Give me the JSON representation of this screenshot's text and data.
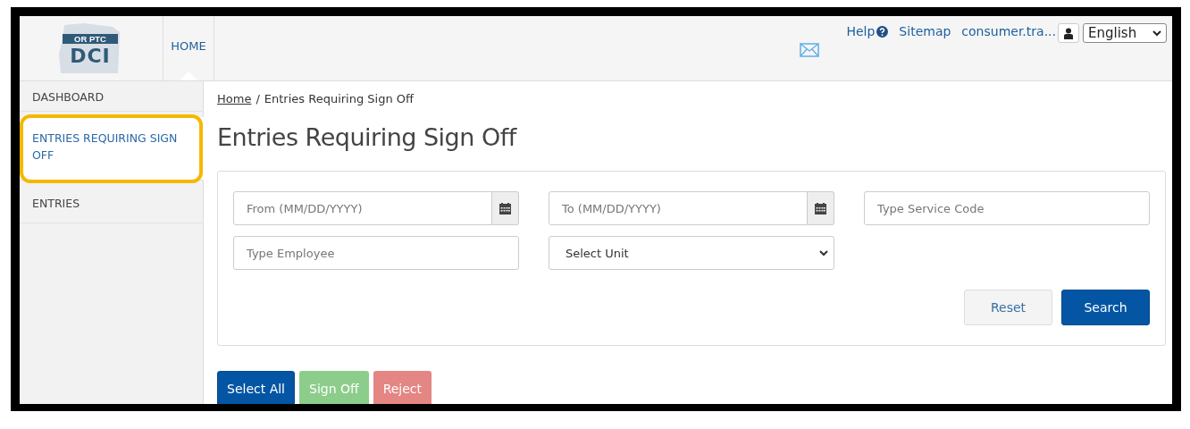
{
  "header": {
    "logo": {
      "tagline": "OR PTC",
      "letters": "DCI"
    },
    "nav": [
      {
        "label": "HOME",
        "selected": true
      }
    ],
    "links": [
      {
        "kind": "help",
        "label": "Help"
      },
      {
        "kind": "link",
        "label": "Sitemap"
      },
      {
        "kind": "link",
        "label": "consumer.tra..."
      }
    ],
    "language": "English"
  },
  "sidebar": {
    "items": [
      {
        "label": "DASHBOARD",
        "selected": false,
        "highlighted": false
      },
      {
        "label": "ENTRIES REQUIRING SIGN OFF",
        "selected": true,
        "highlighted": true
      },
      {
        "label": "ENTRIES",
        "selected": false,
        "highlighted": false
      }
    ]
  },
  "breadcrumb": [
    {
      "label": "Home",
      "link": true
    },
    {
      "label": "/",
      "link": false
    },
    {
      "label": "Entries Requiring Sign Off",
      "link": false
    }
  ],
  "title": "Entries Requiring Sign Off",
  "filters": [
    {
      "kind": "date",
      "placeholder": "From (MM/DD/YYYY)"
    },
    {
      "kind": "date",
      "placeholder": "To (MM/DD/YYYY)"
    },
    {
      "kind": "text",
      "placeholder": "Type Service Code"
    },
    {
      "kind": "text",
      "placeholder": "Type Employee"
    },
    {
      "kind": "select",
      "value": "Select Unit"
    }
  ],
  "filter_buttons": [
    {
      "label": "Reset",
      "kind": "reset",
      "disabled": false
    },
    {
      "label": "Search",
      "kind": "search",
      "disabled": false
    }
  ],
  "actions": [
    {
      "label": "Select All",
      "kind": "select",
      "disabled": false
    },
    {
      "label": "Sign Off",
      "kind": "approve",
      "disabled": true
    },
    {
      "label": "Reject",
      "kind": "reject",
      "disabled": true
    }
  ]
}
